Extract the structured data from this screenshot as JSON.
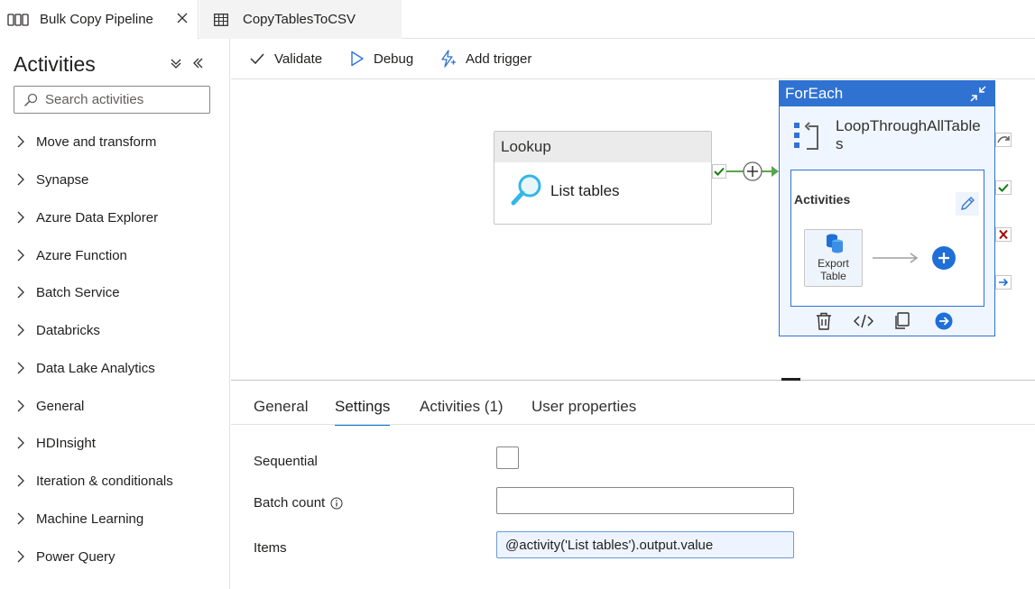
{
  "tabs": [
    {
      "label": "Bulk Copy Pipeline",
      "active": true
    },
    {
      "label": "CopyTablesToCSV",
      "active": false
    }
  ],
  "left_panel": {
    "title": "Activities",
    "search_placeholder": "Search activities",
    "categories": [
      "Move and transform",
      "Synapse",
      "Azure Data Explorer",
      "Azure Function",
      "Batch Service",
      "Databricks",
      "Data Lake Analytics",
      "General",
      "HDInsight",
      "Iteration & conditionals",
      "Machine Learning",
      "Power Query"
    ]
  },
  "toolbar": {
    "validate": "Validate",
    "debug": "Debug",
    "add_trigger": "Add trigger"
  },
  "canvas": {
    "lookup": {
      "type": "Lookup",
      "name": "List tables"
    },
    "foreach": {
      "type": "ForEach",
      "name": "LoopThroughAllTables",
      "inner_label": "Activities",
      "inner_activity": "Export Table"
    }
  },
  "properties": {
    "tabs": [
      "General",
      "Settings",
      "Activities (1)",
      "User properties"
    ],
    "active_tab": "Settings",
    "sequential_label": "Sequential",
    "sequential_checked": false,
    "batch_count_label": "Batch count",
    "batch_count_value": "",
    "items_label": "Items",
    "items_value": "@activity('List tables').output.value"
  },
  "colors": {
    "accent": "#0078d4",
    "foreach_header": "#2f72d2",
    "success": "#107c10",
    "failure": "#a80000"
  }
}
